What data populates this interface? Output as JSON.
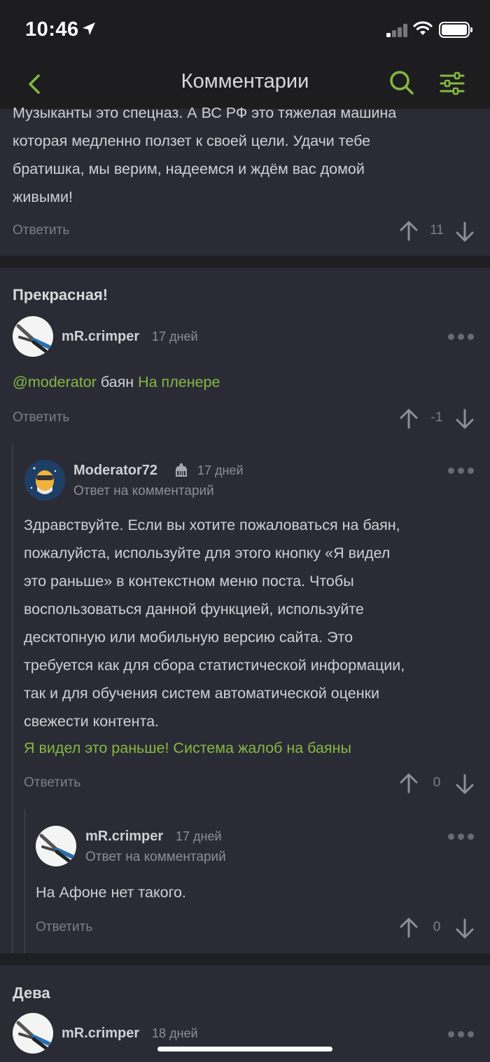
{
  "status_bar": {
    "time": "10:46"
  },
  "nav": {
    "title": "Комментарии",
    "back_icon": "chevron-left-icon",
    "search_icon": "search-icon",
    "filter_icon": "sliders-icon",
    "accent_color": "#84b93f"
  },
  "comment_top": {
    "text_lines": [
      "Музыканты это спецназ. А ВС РФ это тяжелая машина",
      "которая медленно ползет к своей цели. Удачи тебе",
      "братишка, мы верим, надеемся и ждём вас домой",
      "живыми!"
    ],
    "reply_label": "Ответить",
    "score": "11"
  },
  "post_mid": {
    "title": "Прекрасная!",
    "comment": {
      "user": "mR.crimper",
      "date": "17 дней",
      "mention": "@moderator",
      "word": "баян",
      "link": "На пленере",
      "reply_label": "Ответить",
      "score": "-1"
    },
    "reply1": {
      "user": "Moderator72",
      "date": "17 дней",
      "subtitle": "Ответ на комментарий",
      "text_lines": [
        "Здравствуйте. Если вы хотите пожаловаться на баян,",
        "пожалуйста, используйте для этого кнопку «Я видел",
        "это раньше» в контекстном меню поста. Чтобы",
        "воспользоваться данной функцией, используйте",
        "десктопную или мобильную версию сайта. Это",
        "требуется как для сбора статистической информации,",
        "так и для обучения систем автоматической оценки",
        "свежести контента."
      ],
      "links": "Я видел это раньше! Система жалоб на баяны",
      "reply_label": "Ответить",
      "score": "0"
    },
    "reply2": {
      "user": "mR.crimper",
      "date": "17 дней",
      "subtitle": "Ответ на комментарий",
      "text": "На Афоне нет такого.",
      "reply_label": "Ответить",
      "score": "0"
    }
  },
  "post_bot": {
    "title": "Дева",
    "comment": {
      "user": "mR.crimper",
      "date": "18 дней"
    }
  }
}
